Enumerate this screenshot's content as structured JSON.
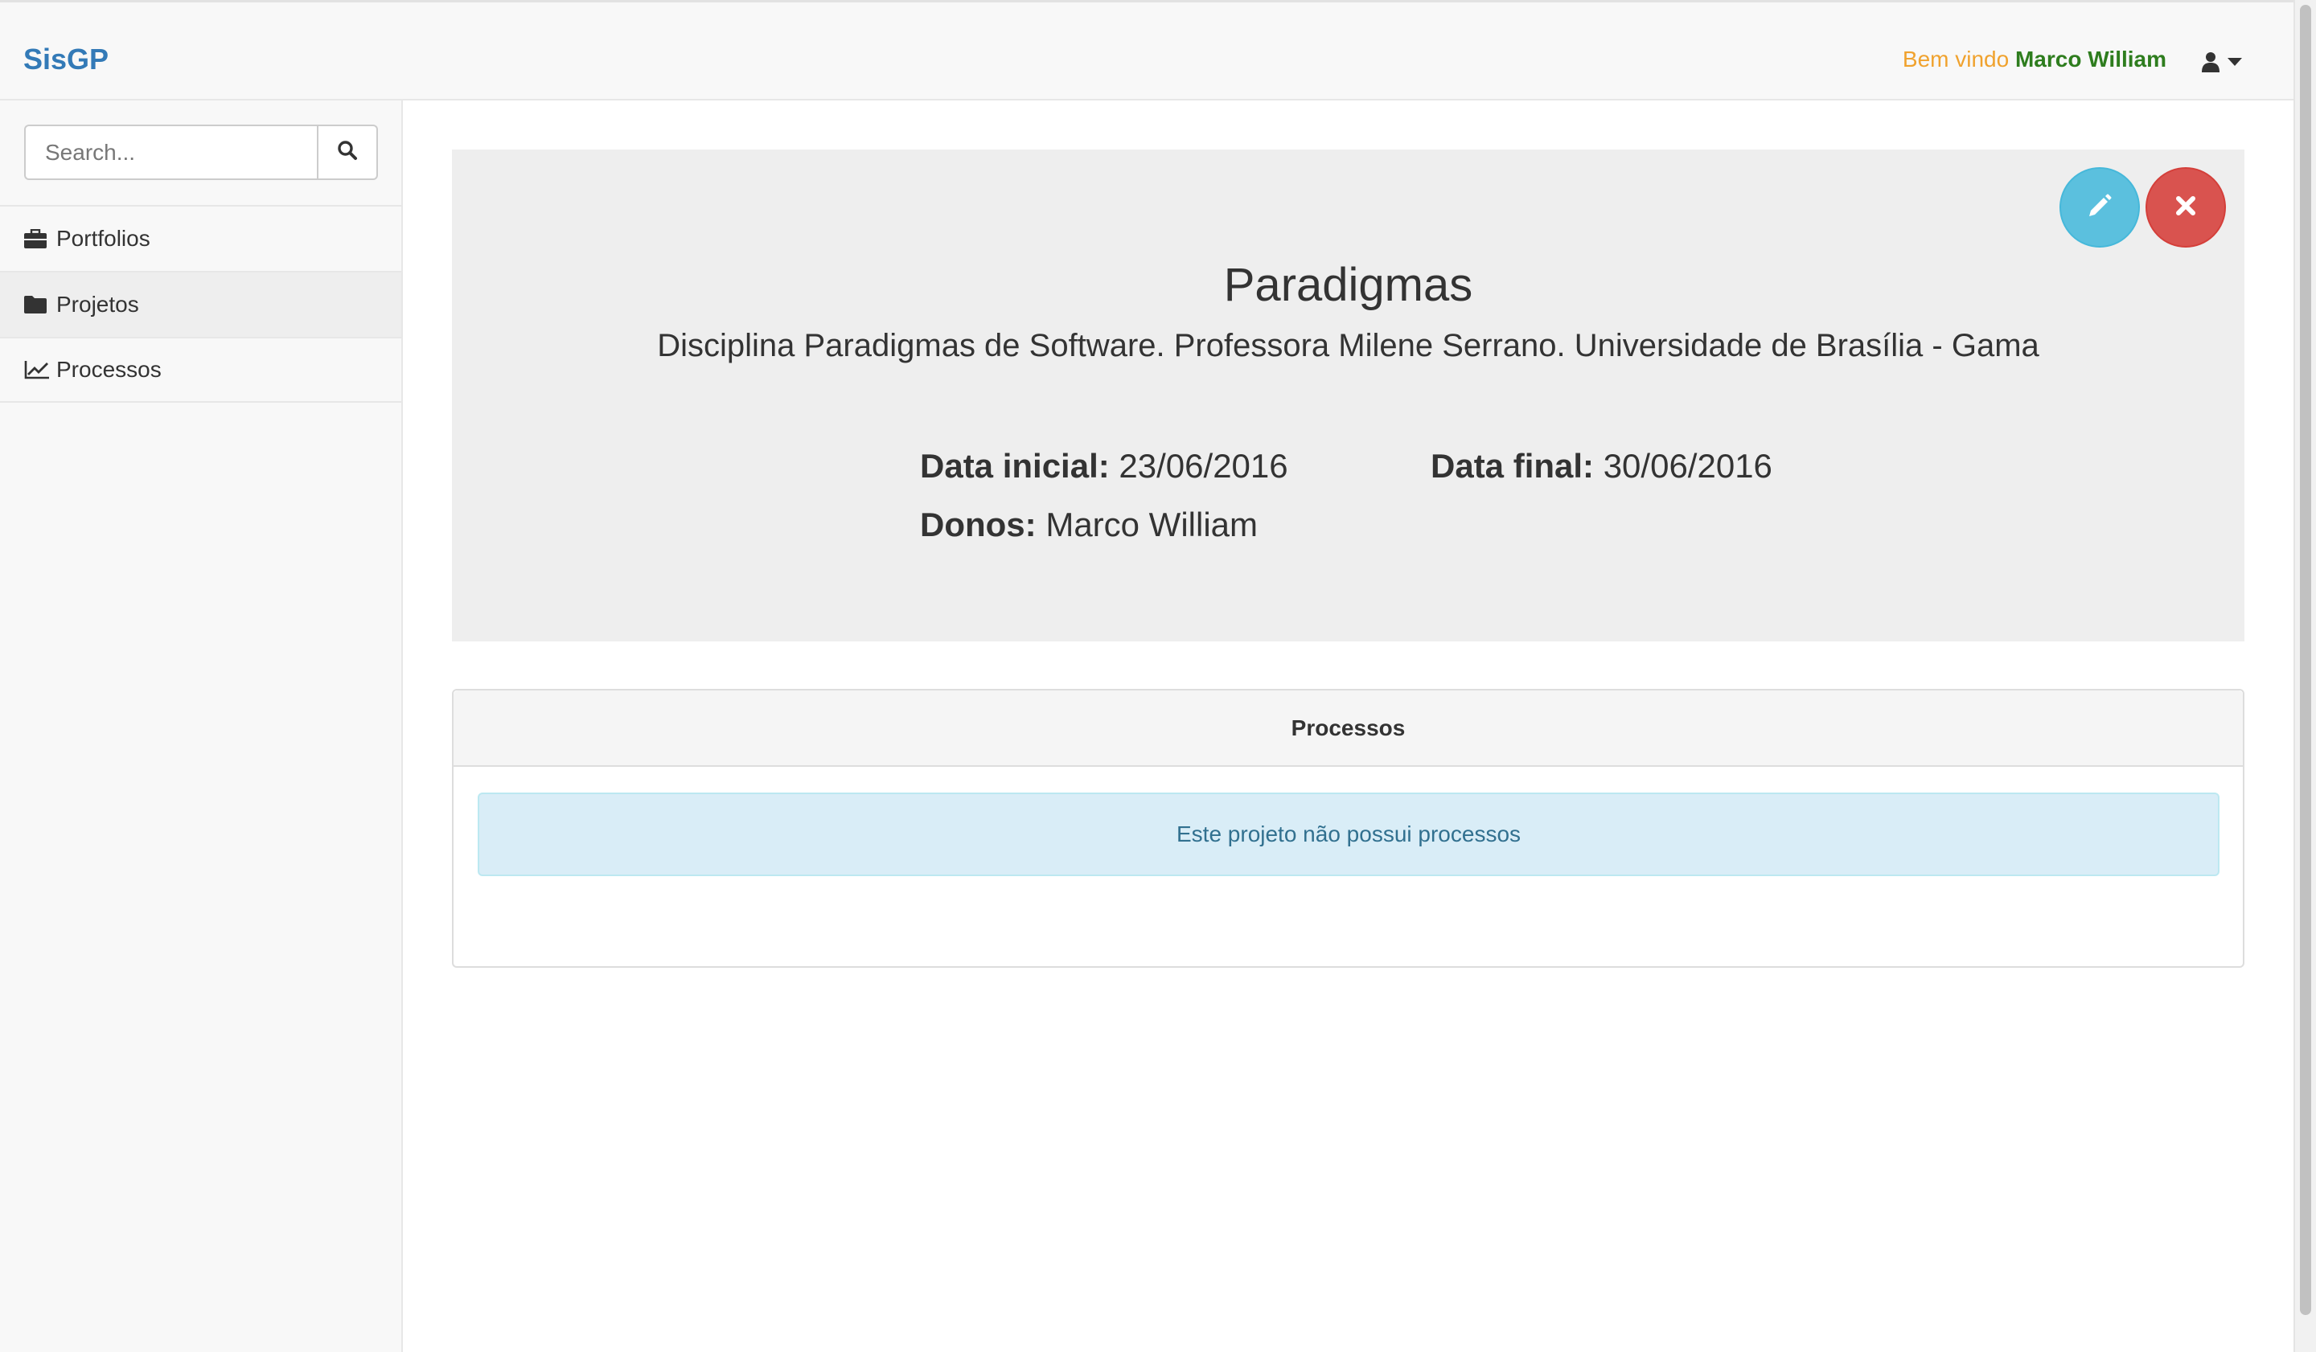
{
  "app": {
    "brand": "SisGP"
  },
  "header": {
    "welcome_label": "Bem vindo",
    "user_name": "Marco William",
    "user_icon": "user-icon",
    "dropdown_icon": "caret-down-icon"
  },
  "sidebar": {
    "search": {
      "placeholder": "Search...",
      "value": "",
      "icon": "search-icon"
    },
    "items": [
      {
        "label": "Portfolios",
        "icon": "briefcase-icon",
        "active": false
      },
      {
        "label": "Projetos",
        "icon": "folder-icon",
        "active": true
      },
      {
        "label": "Processos",
        "icon": "line-chart-icon",
        "active": false
      }
    ]
  },
  "project": {
    "title": "Paradigmas",
    "description": "Disciplina Paradigmas de Software. Professora Milene Serrano. Universidade de Brasília - Gama",
    "start_label": "Data inicial:",
    "start_value": "23/06/2016",
    "end_label": "Data final:",
    "end_value": "30/06/2016",
    "owners_label": "Donos:",
    "owners_value": "Marco William",
    "edit_icon": "pencil-icon",
    "delete_icon": "close-icon"
  },
  "processes_panel": {
    "heading": "Processos",
    "empty_message": "Este projeto não possui processos"
  },
  "colors": {
    "brand": "#337ab7",
    "welcome": "#f0a22e",
    "user_name": "#2e7d1e",
    "edit_button": "#5bc0de",
    "delete_button": "#d9534f",
    "alert_bg": "#d9edf7",
    "alert_text": "#31708f"
  }
}
